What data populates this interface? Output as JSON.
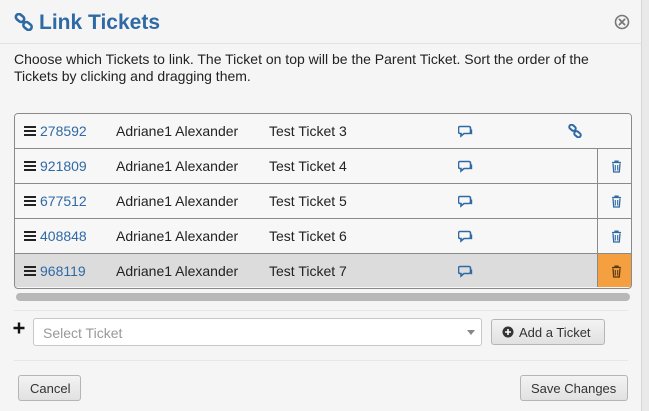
{
  "header": {
    "title": "Link Tickets"
  },
  "instructions": "Choose which Tickets to link. The Ticket on top will be the Parent Ticket. Sort the order of the Tickets by clicking and dragging them.",
  "tickets": [
    {
      "id": "278592",
      "owner": "Adriane1 Alexander",
      "subject": "Test Ticket 3"
    },
    {
      "id": "921809",
      "owner": "Adriane1 Alexander",
      "subject": "Test Ticket 4"
    },
    {
      "id": "677512",
      "owner": "Adriane1 Alexander",
      "subject": "Test Ticket 5"
    },
    {
      "id": "408848",
      "owner": "Adriane1 Alexander",
      "subject": "Test Ticket 6"
    },
    {
      "id": "968119",
      "owner": "Adriane1 Alexander",
      "subject": "Test Ticket 7"
    }
  ],
  "add_ticket": {
    "placeholder": "Select Ticket",
    "button_label": "Add a Ticket"
  },
  "footer": {
    "cancel_label": "Cancel",
    "save_label": "Save Changes"
  },
  "colors": {
    "accent": "#2f6aa5",
    "delete_hover": "#f4a040",
    "selected_row": "#dcdcdc"
  },
  "icons": {
    "title": "link-icon",
    "close": "close-icon",
    "drag": "drag-handle-icon",
    "comment": "comment-icon",
    "parent": "link-icon",
    "delete": "trash-icon",
    "add": "plus-icon",
    "add_button": "plus-circle-icon"
  }
}
